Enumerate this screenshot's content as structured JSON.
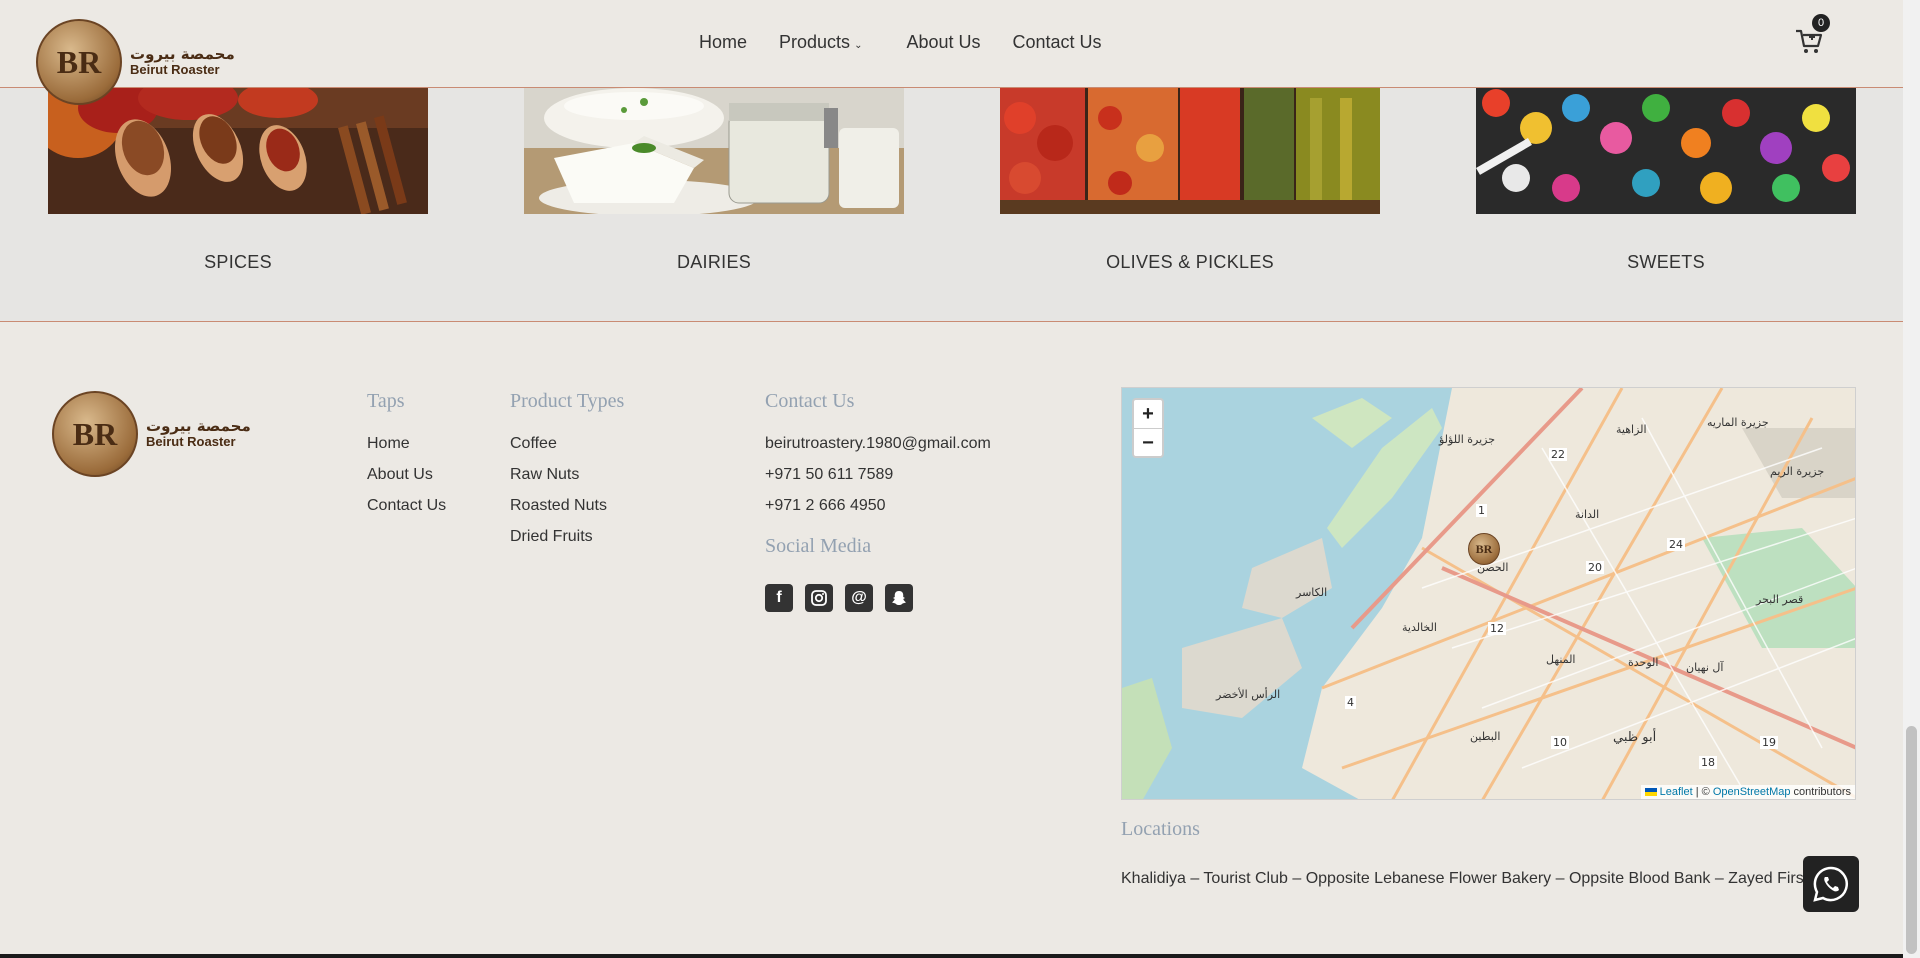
{
  "brand": {
    "monogram": "BR",
    "arabic_name": "محمصة بيروت",
    "english_name": "Beirut Roaster"
  },
  "nav": {
    "items": [
      {
        "label": "Home"
      },
      {
        "label": "Products"
      },
      {
        "label": "About Us"
      },
      {
        "label": "Contact Us"
      }
    ],
    "cart_count": "0"
  },
  "categories": [
    {
      "label": "SPICES",
      "icon": "spices-image"
    },
    {
      "label": "DAIRIES",
      "icon": "dairies-image"
    },
    {
      "label": "OLIVES & PICKLES",
      "icon": "olives-pickles-image"
    },
    {
      "label": "SWEETS",
      "icon": "sweets-image"
    }
  ],
  "footer": {
    "taps": {
      "title": "Taps",
      "links": [
        "Home",
        "About Us",
        "Contact Us"
      ]
    },
    "product_types": {
      "title": "Product Types",
      "links": [
        "Coffee",
        "Raw Nuts",
        "Roasted Nuts",
        "Dried Fruits"
      ]
    },
    "contact": {
      "title": "Contact Us",
      "email": "beirutroastery.1980@gmail.com",
      "phone1": "+971 50 611 7589",
      "phone2": "+971 2 666 4950"
    },
    "social": {
      "title": "Social Media",
      "icons": [
        "facebook-icon",
        "instagram-icon",
        "threads-icon",
        "snapchat-icon"
      ]
    },
    "map": {
      "zoom_in": "+",
      "zoom_out": "−",
      "attribution_leaflet": "Leaflet",
      "attribution_sep": " | © ",
      "attribution_osm": "OpenStreetMap",
      "attribution_suffix": " contributors",
      "labels": [
        "جزيرة اللؤلؤ",
        "الزاهية",
        "جزيرة الماريه",
        "الدانة",
        "جزيرة الريم",
        "الحصن",
        "الكاسر",
        "قصر البحر",
        "الخالدية",
        "الوحدة",
        "المنهل",
        "آل نهيان",
        "الرأس الأخضر",
        "البطين",
        "أبو ظبي"
      ],
      "road_numbers": [
        "22",
        "1",
        "24",
        "20",
        "12",
        "4",
        "10",
        "18",
        "19"
      ]
    },
    "locations": {
      "title": "Locations",
      "text": "Khalidiya – Tourist Club – Opposite Lebanese Flower Bakery – Oppsite Blood Bank – Zayed First"
    }
  },
  "colors": {
    "background": "#ece9e4",
    "accent_line": "#c98b73",
    "muted_heading": "#93a1b1",
    "brown": "#4a2c14"
  }
}
